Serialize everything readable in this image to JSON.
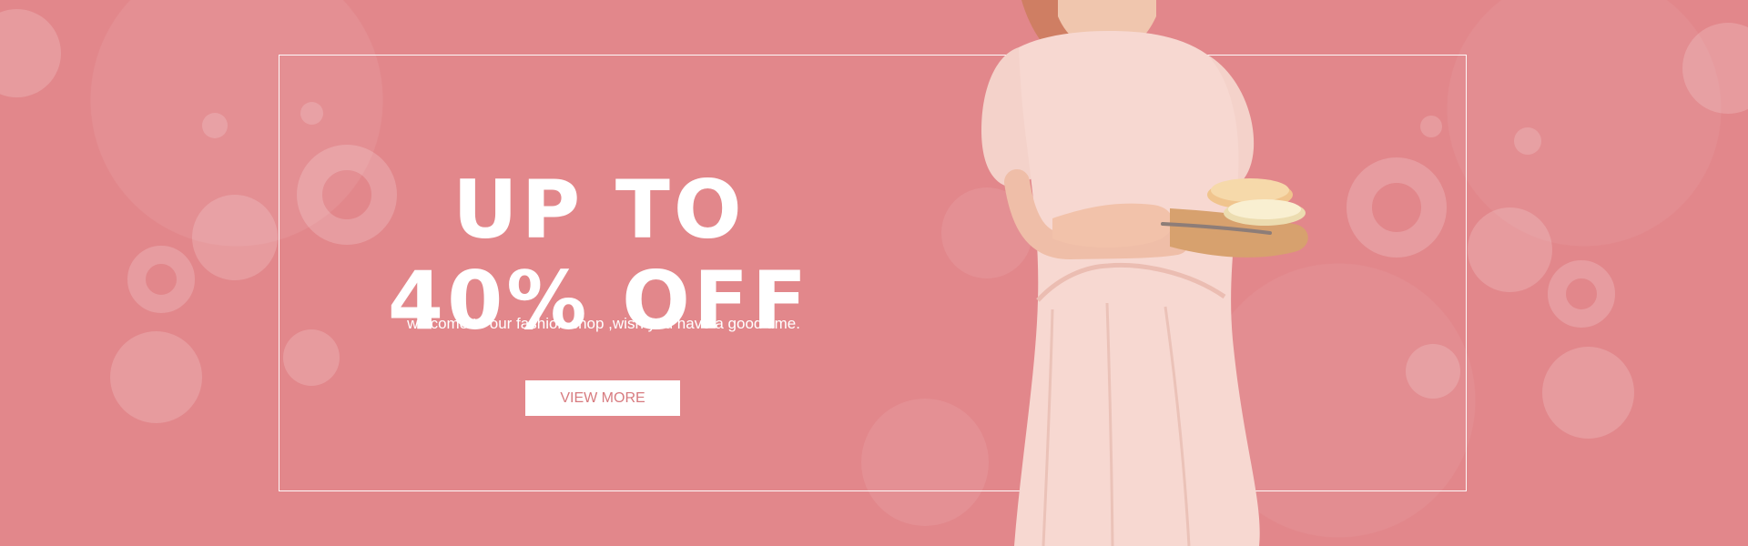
{
  "banner": {
    "headline": {
      "line1": "UP TO",
      "line2": "40% OFF"
    },
    "tagline": "welcome to our fashion shop ,wish you have a good time.",
    "cta_label": "VIEW MORE"
  },
  "colors": {
    "background": "#e2878b",
    "text": "#ffffff",
    "button_background": "#ffffff",
    "button_text": "#d77b7f",
    "dress": "#f6d6cf",
    "hair": "#d17b61"
  }
}
